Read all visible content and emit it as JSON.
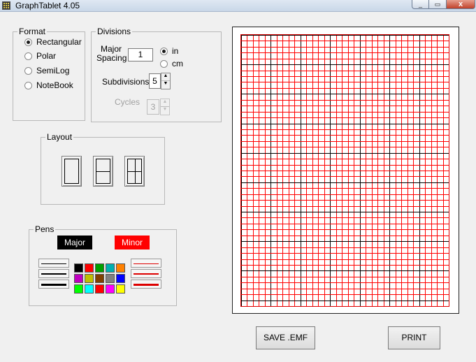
{
  "window": {
    "title": "GraphTablet 4.05",
    "close_glyph": "x",
    "min_glyph": "_",
    "max_glyph": "▭"
  },
  "format": {
    "legend": "Format",
    "options": [
      {
        "label": "Rectangular",
        "selected": true
      },
      {
        "label": "Polar",
        "selected": false
      },
      {
        "label": "SemiLog",
        "selected": false
      },
      {
        "label": "NoteBook",
        "selected": false
      }
    ]
  },
  "divisions": {
    "legend": "Divisions",
    "major_label_1": "Major",
    "major_label_2": "Spacing",
    "major_value": "1",
    "unit_in": "in",
    "unit_cm": "cm",
    "unit_selected": "in",
    "subdivisions_label": "Subdivisions",
    "subdivisions_value": "5",
    "cycles_label": "Cycles",
    "cycles_value": "3"
  },
  "layout": {
    "legend": "Layout"
  },
  "pens": {
    "legend": "Pens",
    "major_label": "Major",
    "minor_label": "Minor",
    "major_color": "#000000",
    "minor_color": "#ff0000",
    "palette": [
      "#000000",
      "#ff0000",
      "#00a000",
      "#00b0b0",
      "#ff8000",
      "#c000c0",
      "#c0c000",
      "#804000",
      "#808080",
      "#0000ff",
      "#00ff00",
      "#00ffff",
      "#ff0000",
      "#ff00ff",
      "#ffff00"
    ]
  },
  "grid": {
    "major_color": "#000000",
    "minor_color": "#ff0000",
    "columns": 35,
    "rows": 46
  },
  "actions": {
    "save_label": "SAVE .EMF",
    "print_label": "PRINT"
  }
}
